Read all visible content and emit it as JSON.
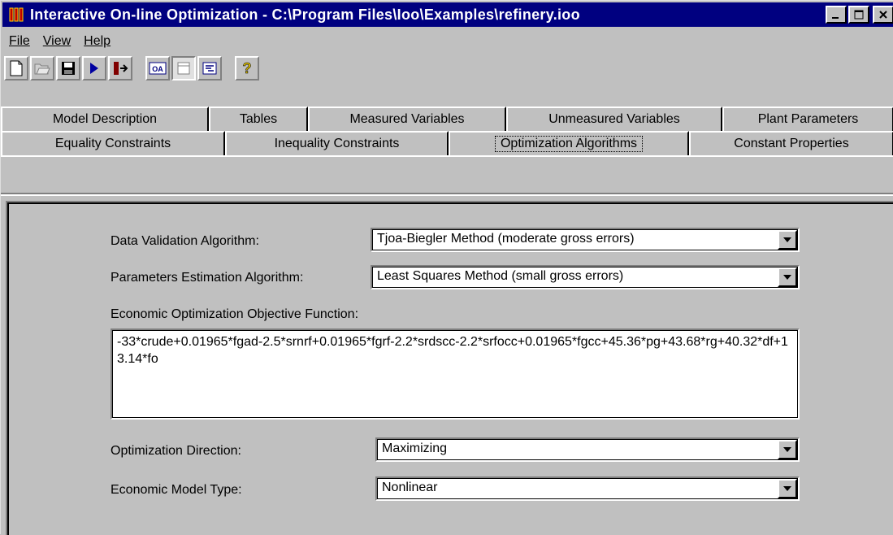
{
  "window": {
    "title": "Interactive On-line Optimization - C:\\Program Files\\Ioo\\Examples\\refinery.ioo",
    "minimize_label": "_",
    "maximize_label": "□",
    "close_label": "✕"
  },
  "menu": {
    "file": "File",
    "view": "View",
    "help": "Help"
  },
  "toolbar": {
    "icons": [
      "new-document-icon",
      "open-folder-icon",
      "save-icon",
      "run-icon",
      "exit-icon",
      "oa-icon",
      "page-icon",
      "tree-icon",
      "help-icon"
    ]
  },
  "tabs": {
    "row1": [
      "Model Description",
      "Tables",
      "Measured Variables",
      "Unmeasured Variables",
      "Plant Parameters"
    ],
    "row2": [
      "Equality Constraints",
      "Inequality Constraints",
      "Optimization Algorithms",
      "Constant Properties"
    ],
    "active": "Optimization Algorithms"
  },
  "form": {
    "data_validation_label": "Data Validation Algorithm:",
    "data_validation_value": "Tjoa-Biegler Method (moderate gross errors)",
    "param_estimation_label": "Parameters Estimation Algorithm:",
    "param_estimation_value": "Least Squares Method (small gross errors)",
    "objective_label": "Economic Optimization Objective Function:",
    "objective_value": "-33*crude+0.01965*fgad-2.5*srnrf+0.01965*fgrf-2.2*srdscc-2.2*srfocc+0.01965*fgcc+45.36*pg+43.68*rg+40.32*df+13.14*fo",
    "direction_label": "Optimization Direction:",
    "direction_value": "Maximizing",
    "model_type_label": "Economic Model Type:",
    "model_type_value": "Nonlinear"
  },
  "colors": {
    "title_bar": "#000080",
    "face": "#c0c0c0"
  }
}
